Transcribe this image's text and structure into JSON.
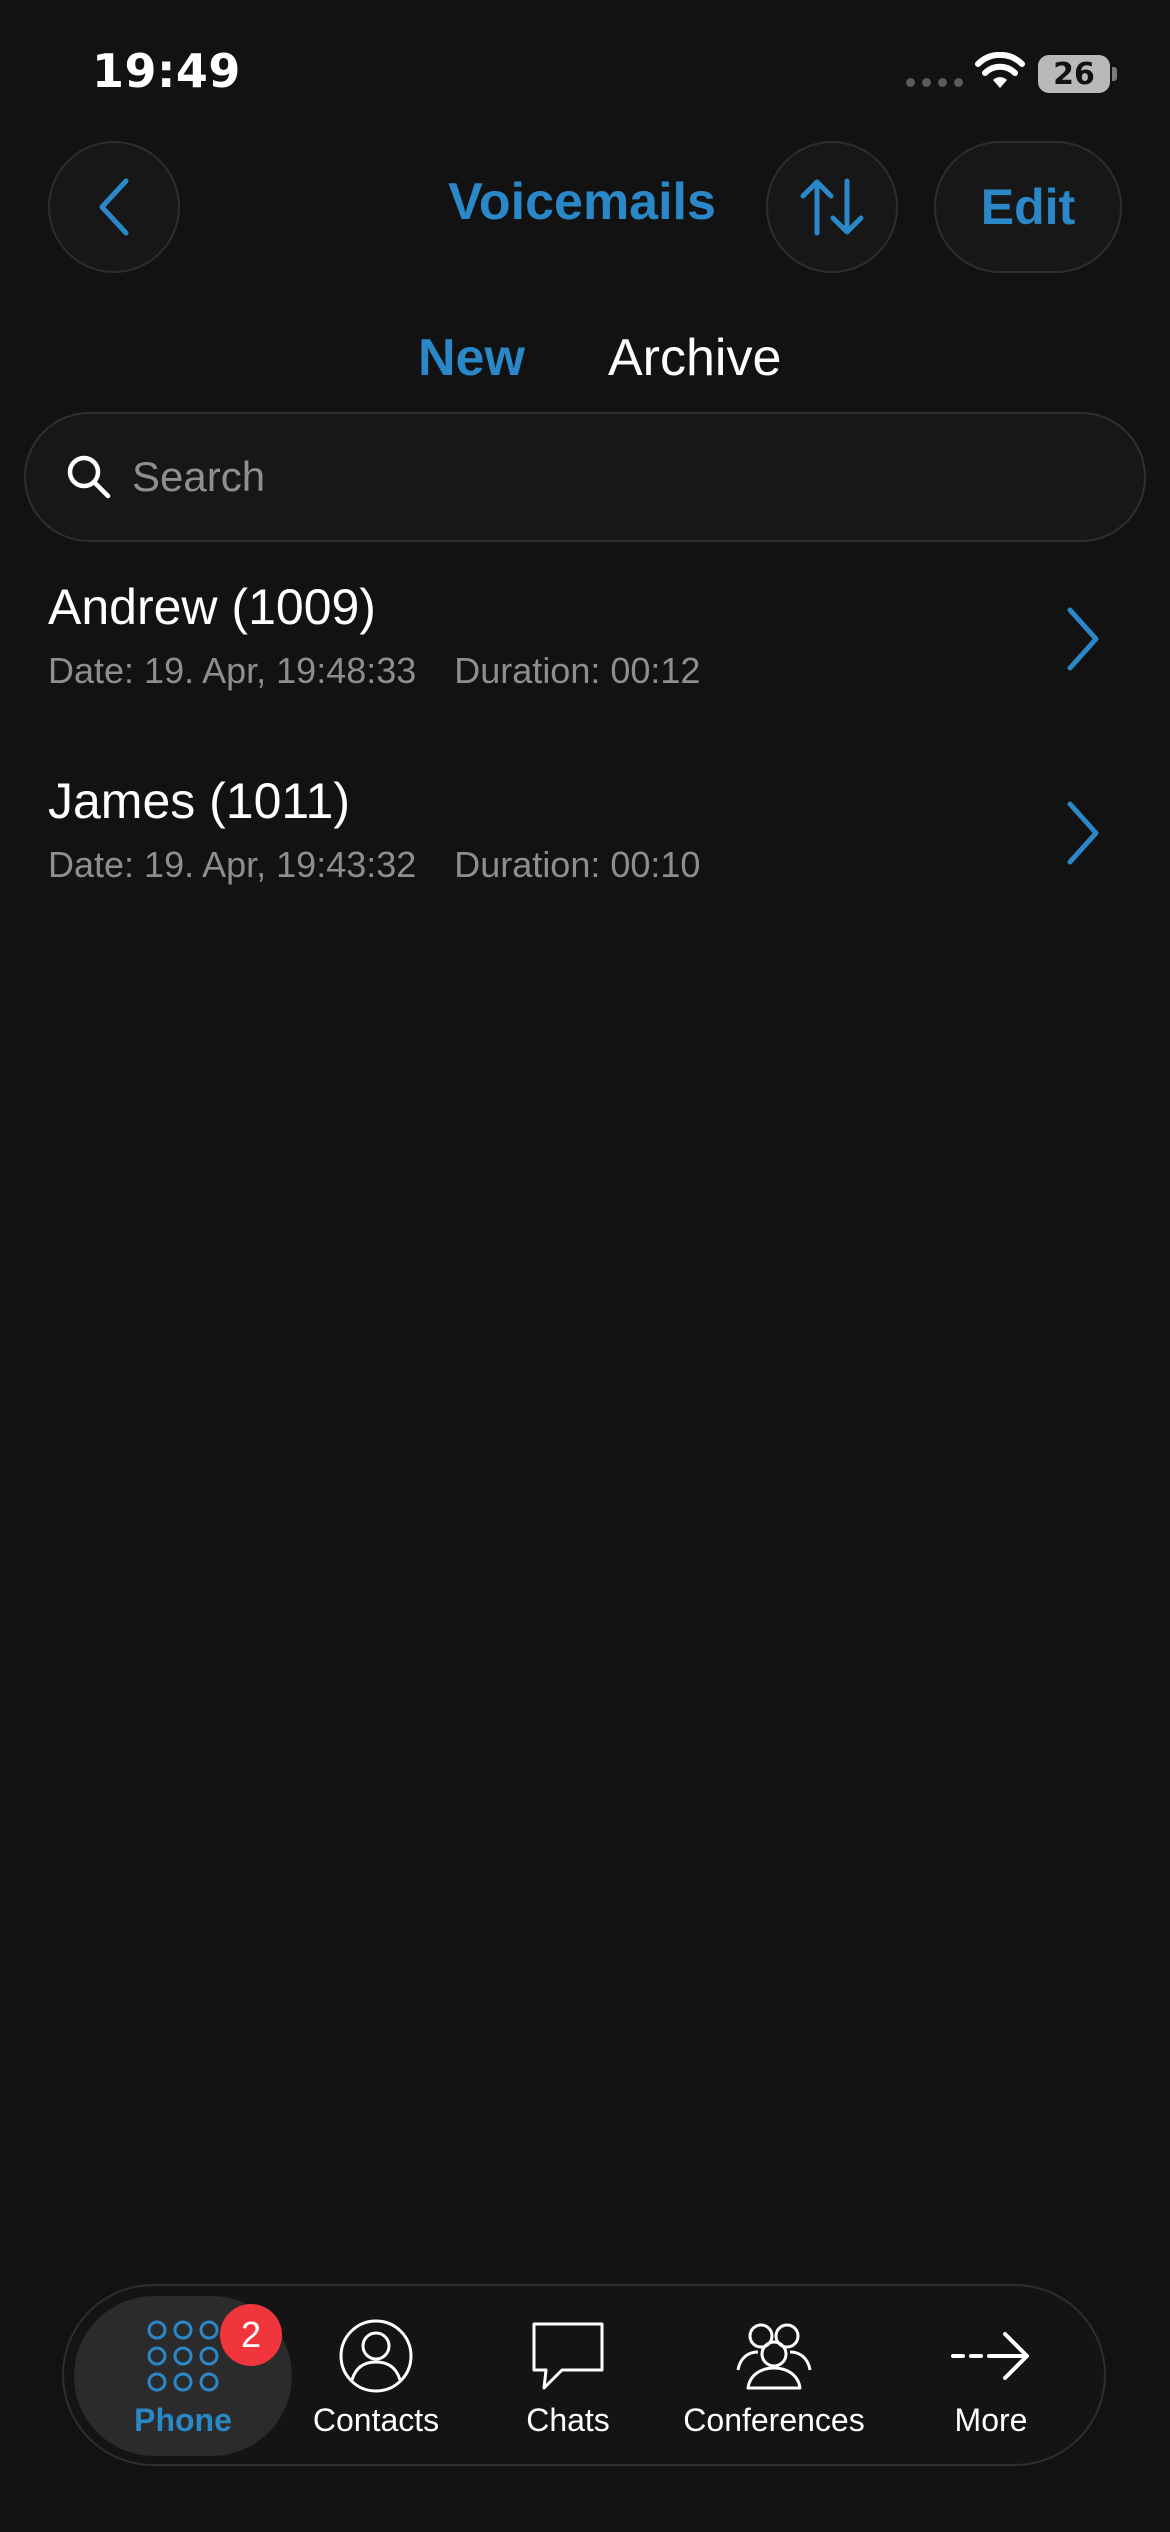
{
  "status_bar": {
    "time": "19:49",
    "battery": "26"
  },
  "header": {
    "title": "Voicemails",
    "edit_label": "Edit"
  },
  "tabs": [
    {
      "label": "New",
      "active": true
    },
    {
      "label": "Archive",
      "active": false
    }
  ],
  "search": {
    "placeholder": "Search",
    "value": ""
  },
  "voicemails": [
    {
      "name": "Andrew (1009)",
      "date": "Date: 19. Apr, 19:48:33",
      "duration": "Duration: 00:12"
    },
    {
      "name": "James (1011)",
      "date": "Date: 19. Apr, 19:43:32",
      "duration": "Duration: 00:10"
    }
  ],
  "nav": {
    "phone": {
      "label": "Phone",
      "badge": "2",
      "icon": "dialpad-icon"
    },
    "contacts": {
      "label": "Contacts",
      "icon": "contact-icon"
    },
    "chats": {
      "label": "Chats",
      "icon": "chat-bubble-icon"
    },
    "conferences": {
      "label": "Conferences",
      "icon": "group-icon"
    },
    "more": {
      "label": "More",
      "icon": "arrow-right-icon"
    }
  },
  "colors": {
    "accent": "#2a88c8",
    "background": "#121212",
    "badge": "#f0353d",
    "muted": "#8e8e8e"
  }
}
